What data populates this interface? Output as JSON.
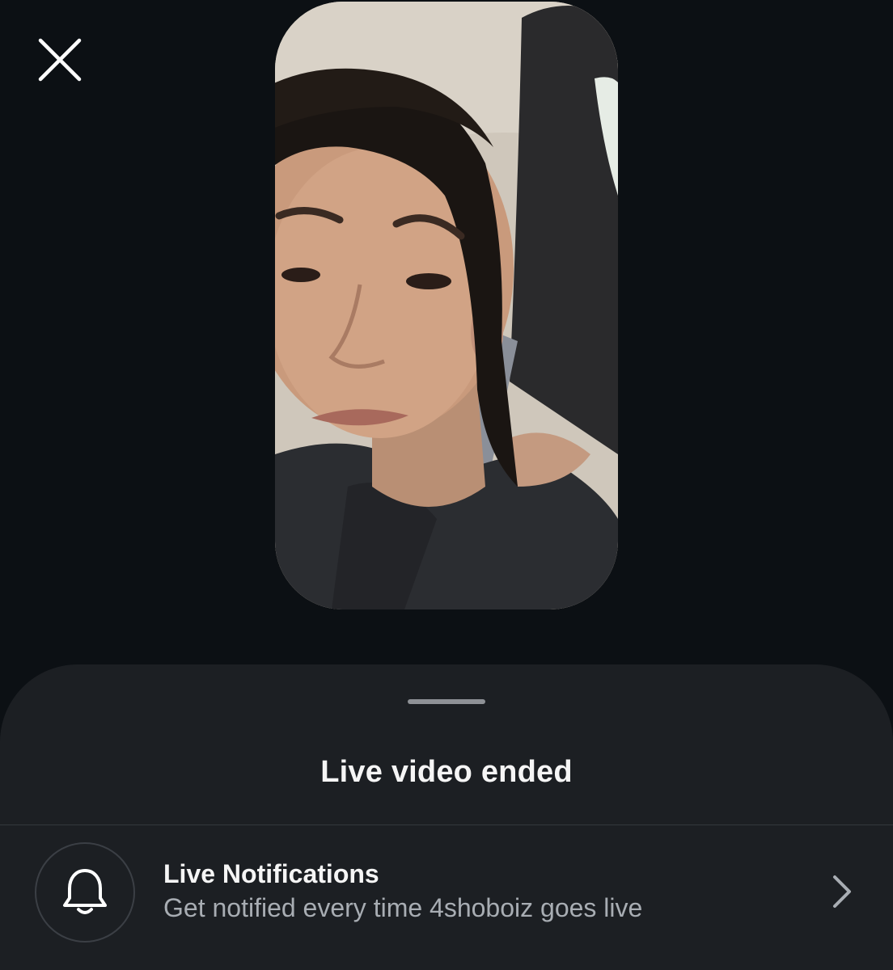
{
  "header": {
    "close_icon": "close-icon"
  },
  "video": {
    "thumbnail": "live-video-thumbnail"
  },
  "sheet": {
    "title": "Live video ended",
    "notification_row": {
      "icon": "bell-icon",
      "title": "Live Notifications",
      "subtitle": "Get notified every time 4shoboiz goes live",
      "chevron_icon": "chevron-right-icon"
    }
  },
  "colors": {
    "background": "#0c1014",
    "sheet": "#1c1f23",
    "primary_text": "#f5f5f5",
    "secondary_text": "#a8adb3"
  }
}
